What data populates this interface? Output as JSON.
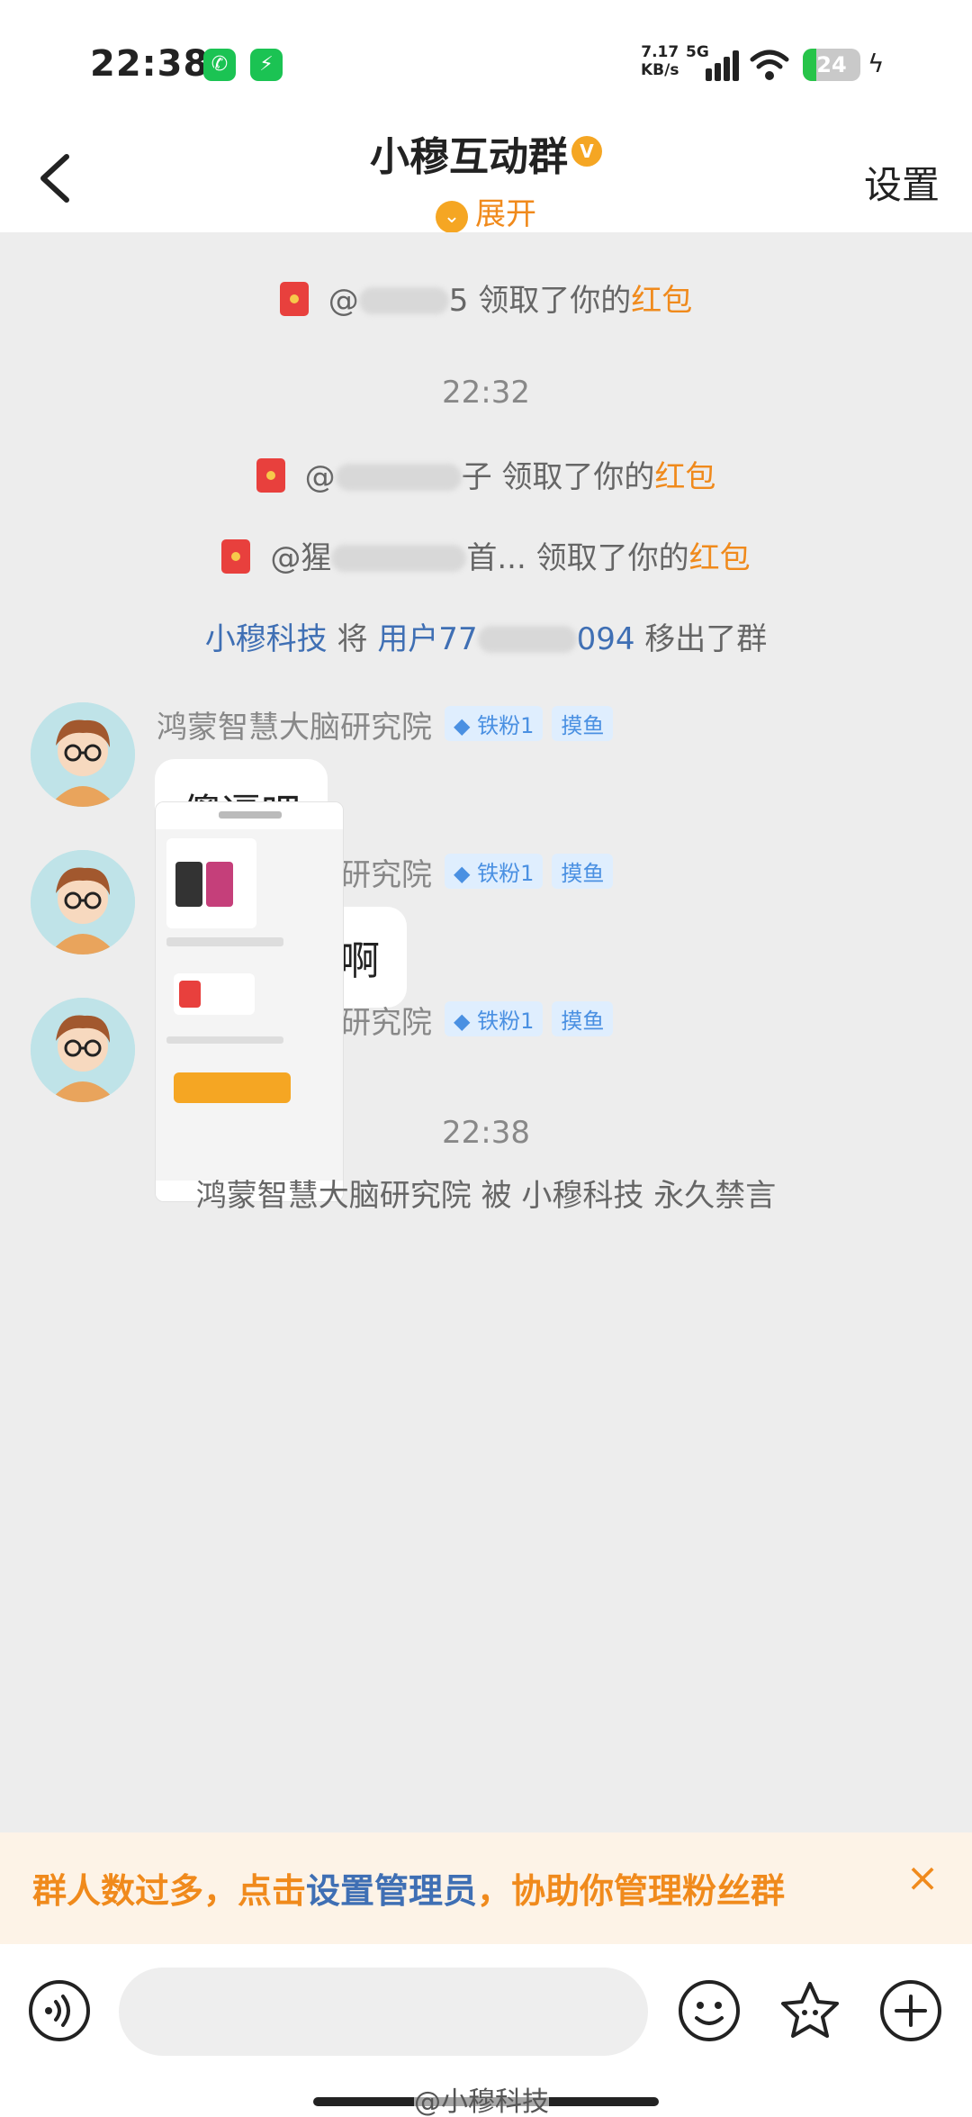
{
  "status_bar": {
    "time": "22:38",
    "net_speed_top": "7.17",
    "net_speed_unit": "KB/s",
    "network": "5G",
    "battery": "24",
    "battery_level": 0.24,
    "icons": [
      "wechat-icon",
      "charge-app-icon",
      "signal-icon",
      "wifi-icon",
      "battery-icon",
      "charging-bolt-icon"
    ]
  },
  "header": {
    "title": "小穆互动群",
    "expand_label": "展开",
    "settings_label": "设置"
  },
  "messages": {
    "rp1": {
      "at": "@",
      "tail": "5 领取了你的",
      "highlight": "红包"
    },
    "time1": "22:32",
    "rp2": {
      "at": "@",
      "tail": "子 领取了你的",
      "highlight": "红包"
    },
    "rp3": {
      "at": "@猩",
      "mid": "首... 领取了你的",
      "highlight": "红包"
    },
    "removed": {
      "actor": "小穆科技",
      "verb": "将",
      "user_prefix": "用户77",
      "user_suffix": "094",
      "action": "移出了群"
    },
    "chat": [
      {
        "name": "鸿蒙智慧大脑研究院",
        "tag_fan": "铁粉1",
        "tag_fish": "摸鱼",
        "text": "傻逼吧"
      },
      {
        "name": "鸿蒙智慧大脑研究院",
        "tag_fan": "铁粉1",
        "tag_fish": "摸鱼",
        "text": "你当你谁啊"
      },
      {
        "name": "鸿蒙智慧大脑研究院",
        "tag_fan": "铁粉1",
        "tag_fish": "摸鱼",
        "image": "screenshot-thumbnail"
      }
    ],
    "time2": "22:38",
    "mute": {
      "user": "鸿蒙智慧大脑研究院",
      "verb": "被",
      "actor": "小穆科技",
      "action": "永久禁言"
    }
  },
  "notice": {
    "prefix": "群人数过多，点击",
    "link": "设置管理员",
    "suffix": "，协助你管理粉丝群"
  },
  "input_bar": {
    "placeholder": "",
    "watermark": "@小穆科技"
  },
  "colors": {
    "accent_orange": "#f08a1c",
    "link_blue": "#3f6fb4",
    "background": "#ededed"
  }
}
